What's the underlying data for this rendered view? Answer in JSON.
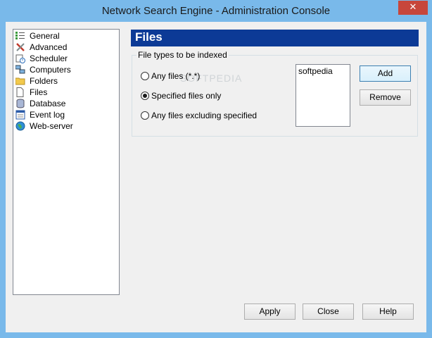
{
  "window": {
    "title": "Network Search Engine - Administration Console",
    "close_glyph": "✕"
  },
  "sidebar": {
    "items": [
      {
        "label": "General",
        "icon": "list-icon"
      },
      {
        "label": "Advanced",
        "icon": "tools-icon"
      },
      {
        "label": "Scheduler",
        "icon": "scheduler-icon"
      },
      {
        "label": "Computers",
        "icon": "computers-icon"
      },
      {
        "label": "Folders",
        "icon": "folder-icon"
      },
      {
        "label": "Files",
        "icon": "file-icon"
      },
      {
        "label": "Database",
        "icon": "database-icon"
      },
      {
        "label": "Event log",
        "icon": "event-log-icon"
      },
      {
        "label": "Web-server",
        "icon": "globe-icon"
      }
    ]
  },
  "panel": {
    "title": "Files",
    "group_label": "File types to be indexed",
    "options": [
      {
        "label": "Any files (*.*)",
        "selected": false
      },
      {
        "label": "Specified files only",
        "selected": true
      },
      {
        "label": "Any files excluding specified",
        "selected": false
      }
    ],
    "file_list": [
      "softpedia"
    ],
    "add_label": "Add",
    "remove_label": "Remove",
    "watermark": "SOFTPEDIA"
  },
  "footer": {
    "apply_label": "Apply",
    "close_label": "Close",
    "help_label": "Help"
  },
  "colors": {
    "header_bg": "#0c3a96",
    "frame": "#79b9ea",
    "close_btn": "#c7463b"
  }
}
